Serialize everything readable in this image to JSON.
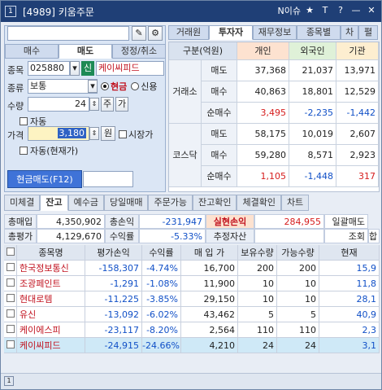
{
  "titlebar": {
    "badge": "1",
    "code": "[4989]",
    "title": "키움주문",
    "news": "N이슈",
    "icons": [
      "star-icon",
      "text-icon",
      "help-icon",
      "minimize-icon",
      "close-icon"
    ]
  },
  "left": {
    "tabs": [
      "매수",
      "매도",
      "정정/취소"
    ],
    "stock_label": "종목",
    "stock_code": "025880",
    "stock_name": "케이씨피드",
    "kind_label": "종류",
    "kind_value": "보통",
    "radio_cash": "현금",
    "radio_credit": "신용",
    "qty_label": "수량",
    "qty_value": "24",
    "qty_btn1": "주",
    "qty_btn2": "가",
    "auto_label": "자동",
    "price_label": "가격",
    "price_value": "3,180",
    "price_unit": "원",
    "market_label": "시장가",
    "auto_current": "자동(현재가)",
    "sell_button": "현금매도(F12)"
  },
  "right_top": {
    "tabs": [
      "거래원",
      "투자자",
      "재무정보",
      "종목별",
      "차",
      "펼"
    ],
    "header": [
      "구분(억원)",
      "개인",
      "외국인",
      "기관"
    ],
    "groups": [
      {
        "name": "거래소",
        "rows": [
          {
            "label": "매도",
            "v": [
              "37,368",
              "21,037",
              "13,971"
            ],
            "cls": [
              "",
              "",
              ""
            ]
          },
          {
            "label": "매수",
            "v": [
              "40,863",
              "18,801",
              "12,529"
            ],
            "cls": [
              "",
              "",
              ""
            ]
          },
          {
            "label": "순매수",
            "v": [
              "3,495",
              "-2,235",
              "-1,442"
            ],
            "cls": [
              "pos",
              "neg",
              "neg"
            ]
          }
        ]
      },
      {
        "name": "코스닥",
        "rows": [
          {
            "label": "매도",
            "v": [
              "58,175",
              "10,019",
              "2,607"
            ],
            "cls": [
              "",
              "",
              ""
            ]
          },
          {
            "label": "매수",
            "v": [
              "59,280",
              "8,571",
              "2,923"
            ],
            "cls": [
              "",
              "",
              ""
            ]
          },
          {
            "label": "순매수",
            "v": [
              "1,105",
              "-1,448",
              "317"
            ],
            "cls": [
              "pos",
              "neg",
              "pos"
            ]
          }
        ]
      }
    ]
  },
  "bottom": {
    "tabs": [
      "미체결",
      "잔고",
      "예수금",
      "당일매매",
      "주문가능",
      "잔고확인",
      "체결확인",
      "차트"
    ],
    "summary": {
      "total_buy_label": "총매입",
      "total_buy": "4,350,902",
      "total_pl_label": "총손익",
      "total_pl": "-231,947",
      "realized_label": "실현손익",
      "realized": "284,955",
      "sell_all": "일괄매도",
      "total_eval_label": "총평가",
      "total_eval": "4,129,670",
      "return_label": "수익률",
      "return": "-5.33%",
      "est_asset_label": "추정자산",
      "lookup": "조회",
      "sum": "합"
    },
    "columns": [
      "종목명",
      "평가손익",
      "수익률",
      "매 입 가",
      "보유수량",
      "가능수량",
      "현재"
    ],
    "rows": [
      {
        "name": "한국정보통신",
        "pl": "-158,307",
        "rate": "-4.74%",
        "buy": "16,700",
        "hold": "200",
        "avail": "200",
        "cur": "15,9",
        "sel": false
      },
      {
        "name": "조광페인트",
        "pl": "-1,291",
        "rate": "-1.08%",
        "buy": "11,900",
        "hold": "10",
        "avail": "10",
        "cur": "11,8",
        "sel": false
      },
      {
        "name": "현대로템",
        "pl": "-11,225",
        "rate": "-3.85%",
        "buy": "29,150",
        "hold": "10",
        "avail": "10",
        "cur": "28,1",
        "sel": false
      },
      {
        "name": "유신",
        "pl": "-13,092",
        "rate": "-6.02%",
        "buy": "43,462",
        "hold": "5",
        "avail": "5",
        "cur": "40,9",
        "sel": false
      },
      {
        "name": "케이에스피",
        "pl": "-23,117",
        "rate": "-8.20%",
        "buy": "2,564",
        "hold": "110",
        "avail": "110",
        "cur": "2,3",
        "sel": false
      },
      {
        "name": "케이씨피드",
        "pl": "-24,915",
        "rate": "-24.66%",
        "buy": "4,210",
        "hold": "24",
        "avail": "24",
        "cur": "3,1",
        "sel": true
      }
    ]
  },
  "colors": {
    "title": "#1f3f76",
    "positive": "#d61d1d",
    "negative": "#1150c7",
    "sell_button": "#3f73d8"
  }
}
